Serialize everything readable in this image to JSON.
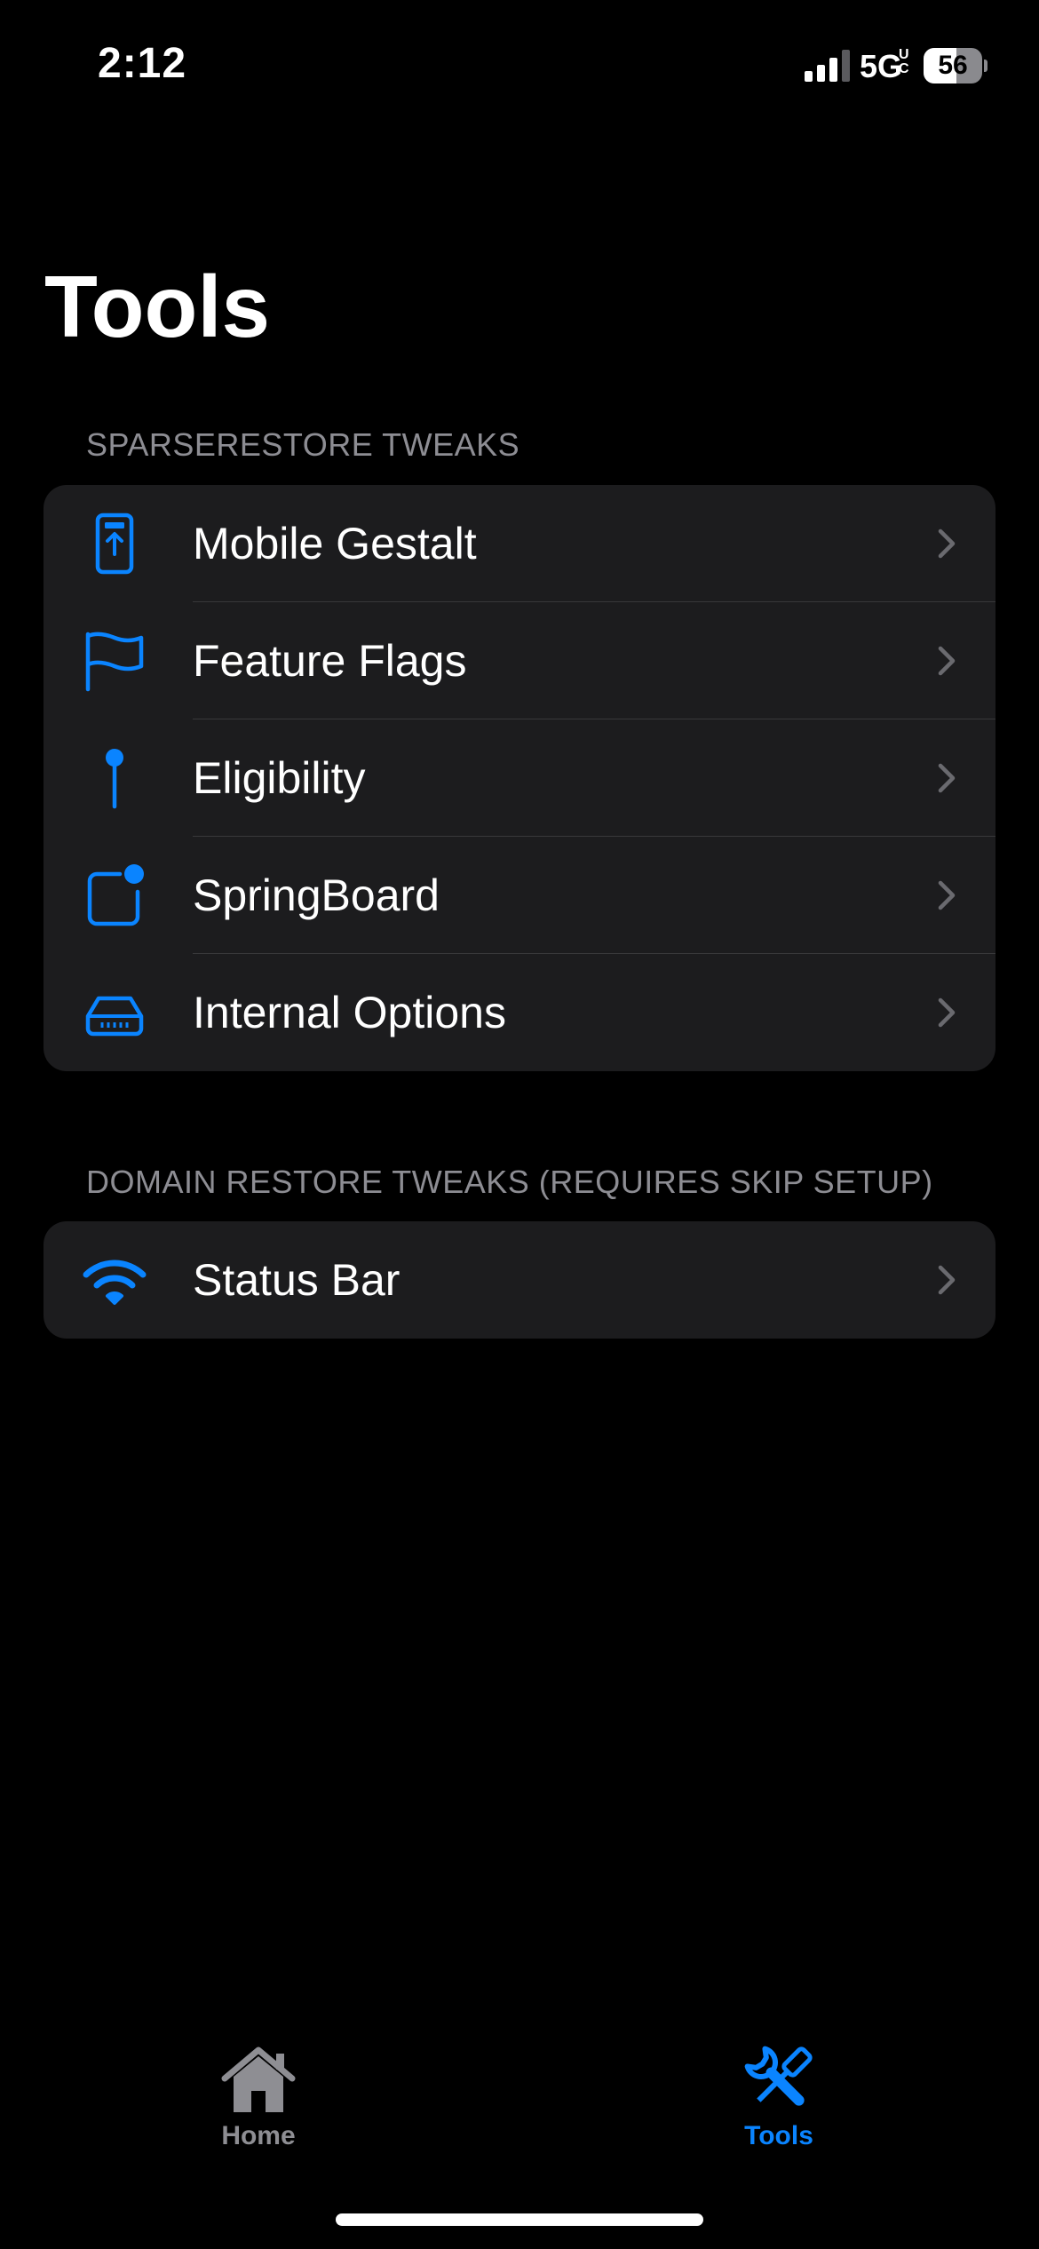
{
  "status_bar": {
    "time": "2:12",
    "network": "5G",
    "network_suffix": "UC",
    "battery": "56",
    "battery_level": 0.56
  },
  "page": {
    "title": "Tools"
  },
  "sections": [
    {
      "header": "SPARSERESTORE TWEAKS",
      "items": [
        {
          "label": "Mobile Gestalt",
          "icon": "phone-upload-icon"
        },
        {
          "label": "Feature Flags",
          "icon": "flag-icon"
        },
        {
          "label": "Eligibility",
          "icon": "pin-icon"
        },
        {
          "label": "SpringBoard",
          "icon": "app-badge-icon"
        },
        {
          "label": "Internal Options",
          "icon": "drive-icon"
        }
      ]
    },
    {
      "header": "DOMAIN RESTORE TWEAKS (REQUIRES SKIP SETUP)",
      "items": [
        {
          "label": "Status Bar",
          "icon": "wifi-icon"
        }
      ]
    }
  ],
  "tab_bar": {
    "tabs": [
      {
        "label": "Home",
        "icon": "house-icon",
        "selected": false
      },
      {
        "label": "Tools",
        "icon": "wrench-screwdriver-icon",
        "selected": true
      }
    ]
  },
  "colors": {
    "accent": "#0a84ff",
    "background": "#000000",
    "group_background": "#1c1c1e",
    "secondary_text": "#8d8d93",
    "inactive_tab": "#8e8e93"
  }
}
